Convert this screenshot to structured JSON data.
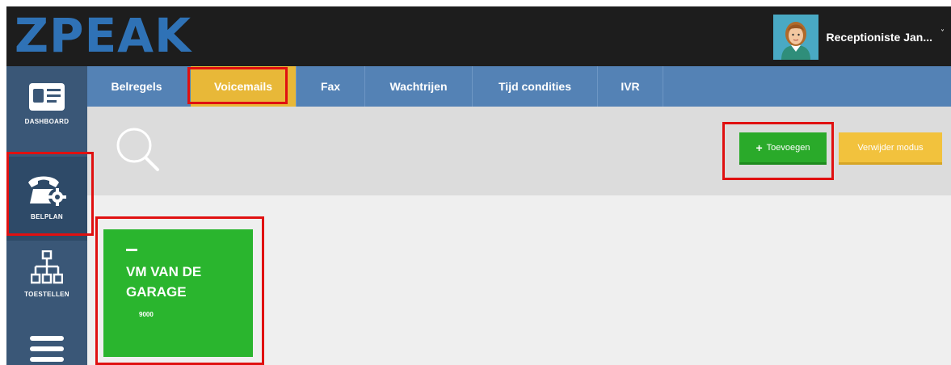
{
  "brand": {
    "logo": "ZPEAK",
    "logo_color": "#2f72b6"
  },
  "user": {
    "name": "Receptioniste Jan...",
    "caret": "˅"
  },
  "sidebar": {
    "items": [
      {
        "label": "DASHBOARD",
        "icon": "dashboard-card-icon"
      },
      {
        "label": "BELPLAN",
        "icon": "phone-gear-icon",
        "active": true
      },
      {
        "label": "TOESTELLEN",
        "icon": "devices-tree-icon"
      },
      {
        "label": "",
        "icon": "menu-icon"
      }
    ]
  },
  "tabs": [
    {
      "label": "Belregels"
    },
    {
      "label": "Voicemails",
      "active": true
    },
    {
      "label": "Fax"
    },
    {
      "label": "Wachtrijen"
    },
    {
      "label": "Tijd condities"
    },
    {
      "label": "IVR"
    }
  ],
  "toolbar": {
    "add_label": "Toevoegen",
    "add_plus": "+",
    "delete_label": "Verwijder modus"
  },
  "voicemails": [
    {
      "name": "VM VAN DE GARAGE",
      "number": "9000"
    }
  ],
  "colors": {
    "topbar": "#1d1d1d",
    "sidebar": "#3a5777",
    "tabbar": "#5482b5",
    "tab_active": "#e8b838",
    "add_button": "#2aaa2a",
    "delete_button": "#f2c23d",
    "card": "#2ab52e",
    "highlight": "#e01010"
  }
}
